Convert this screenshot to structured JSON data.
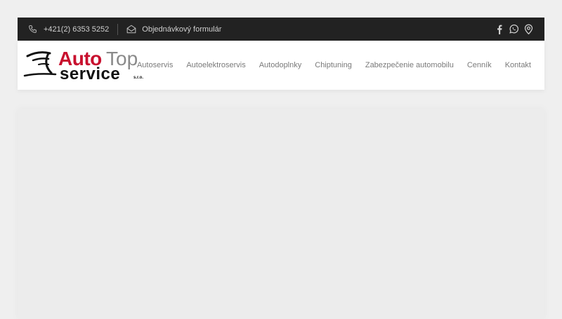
{
  "topbar": {
    "phone": "+421(2) 6353 5252",
    "order_form": "Objednávkový formulár",
    "icons": [
      "phone-icon",
      "envelope-icon",
      "facebook-icon",
      "whatsapp-icon",
      "map-pin-icon"
    ]
  },
  "logo": {
    "auto": "Auto",
    "top": "Top",
    "service": "service",
    "sro": "s.r.o."
  },
  "nav": {
    "items": [
      {
        "label": "Autoservis"
      },
      {
        "label": "Autoelektroservis"
      },
      {
        "label": "Autodoplnky"
      },
      {
        "label": "Chiptuning"
      },
      {
        "label": "Zabezpečenie automobilu"
      },
      {
        "label": "Cenník"
      },
      {
        "label": "Kontakt"
      }
    ]
  },
  "colors": {
    "topbar_bg": "#222222",
    "brand_red": "#c8102e",
    "page_bg": "#efefef"
  }
}
